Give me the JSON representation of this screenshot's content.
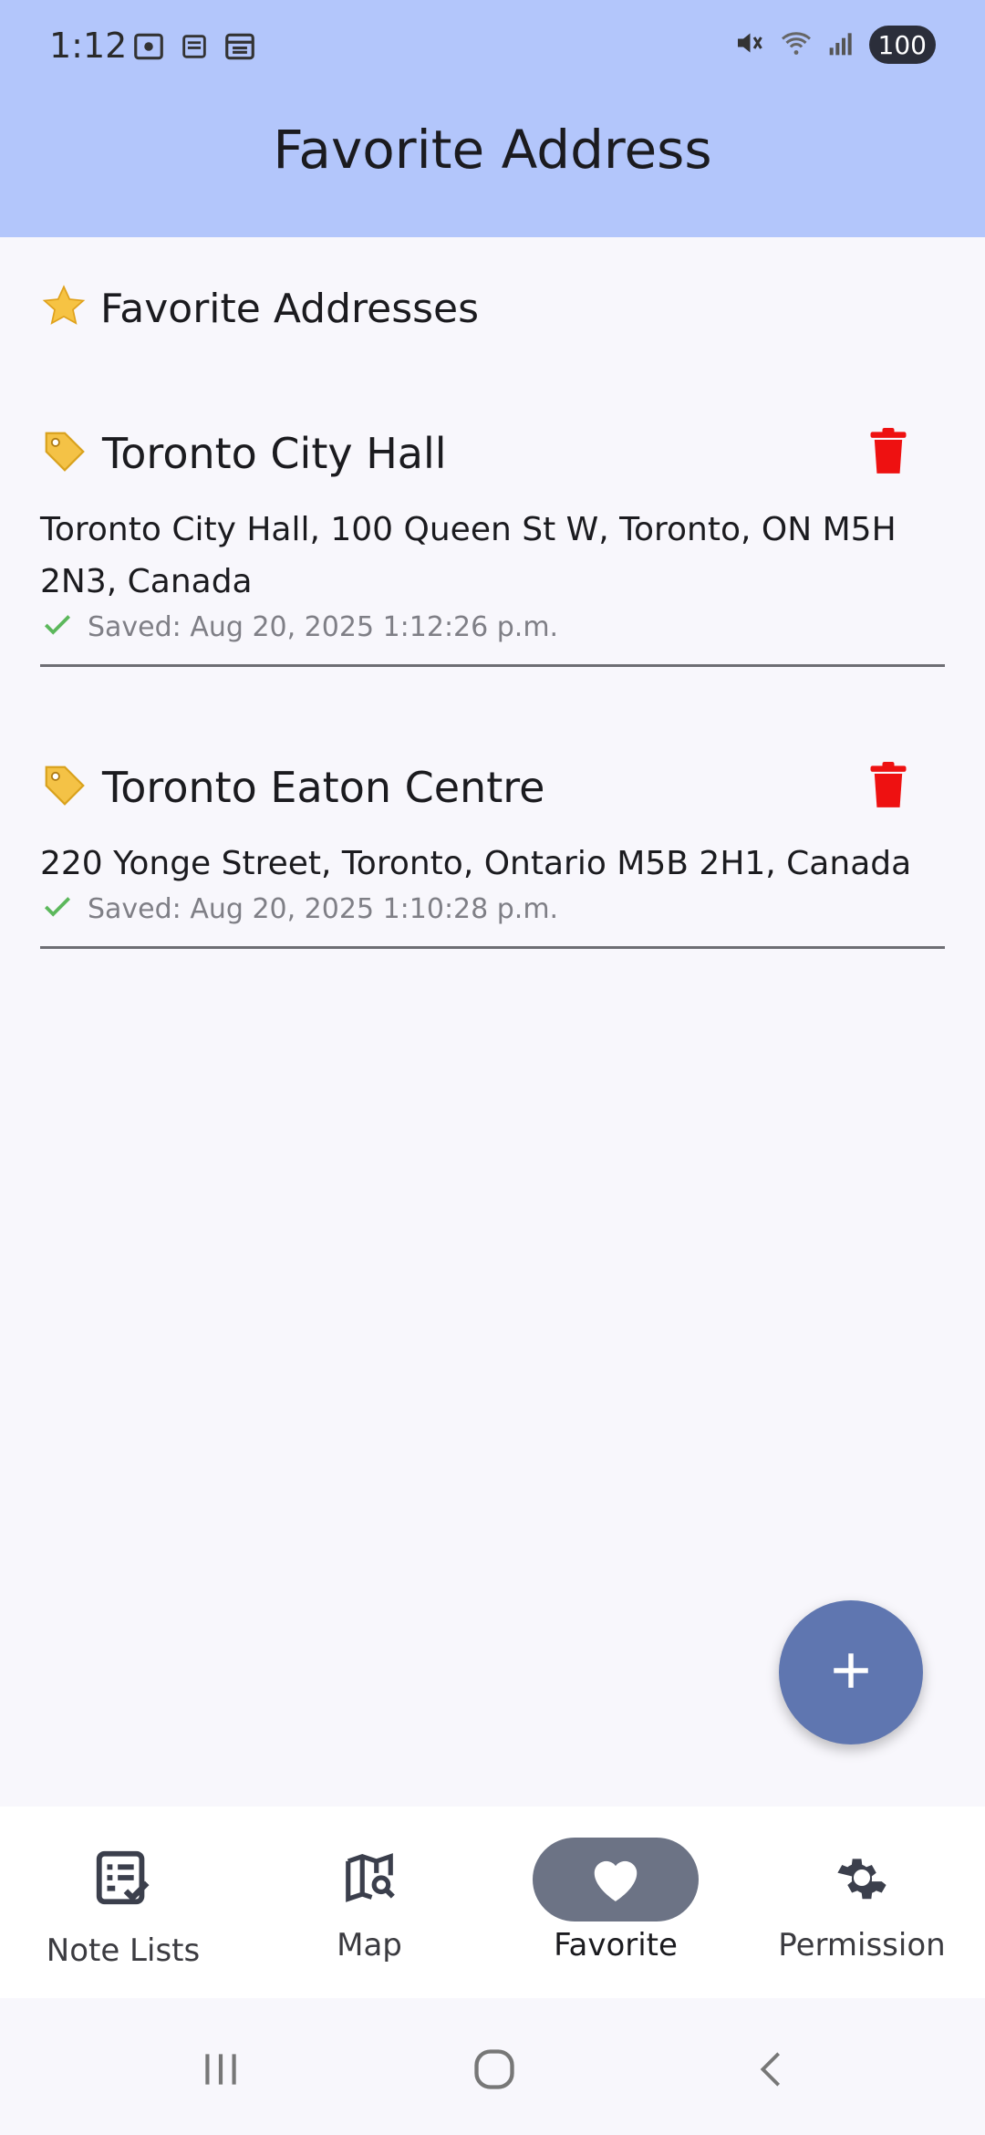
{
  "status_bar": {
    "time": "1:12",
    "battery": "100",
    "icons_left": [
      "screenshot-icon",
      "cast-icon",
      "calendar-icon"
    ],
    "icons_right": [
      "mute-icon",
      "wifi-icon",
      "signal-icon"
    ]
  },
  "app_bar": {
    "title": "Favorite Address"
  },
  "section": {
    "icon": "star",
    "title": "Favorite Addresses"
  },
  "favorites": [
    {
      "name": "Toronto City Hall",
      "address": "Toronto City Hall, 100 Queen St W, Toronto, ON M5H 2N3, Canada",
      "saved": "Saved: Aug 20, 2025 1:12:26 p.m."
    },
    {
      "name": "Toronto Eaton Centre",
      "address": "220 Yonge Street, Toronto, Ontario M5B 2H1, Canada",
      "saved": "Saved: Aug 20, 2025 1:10:28 p.m."
    }
  ],
  "fab": {
    "label": "+"
  },
  "bottom_nav": {
    "items": [
      {
        "label": "Note Lists",
        "icon": "note-list-icon",
        "active": false
      },
      {
        "label": "Map",
        "icon": "map-search-icon",
        "active": false
      },
      {
        "label": "Favorite",
        "icon": "heart-icon",
        "active": true
      },
      {
        "label": "Permission",
        "icon": "gear-icon",
        "active": false
      }
    ]
  },
  "colors": {
    "app_bar_bg": "#b3c6fb",
    "background": "#f8f7fc",
    "fab": "#5f76b0",
    "delete_red": "#ee1111",
    "check_green": "#5cb85c",
    "nav_active_pill": "#6c7385"
  }
}
